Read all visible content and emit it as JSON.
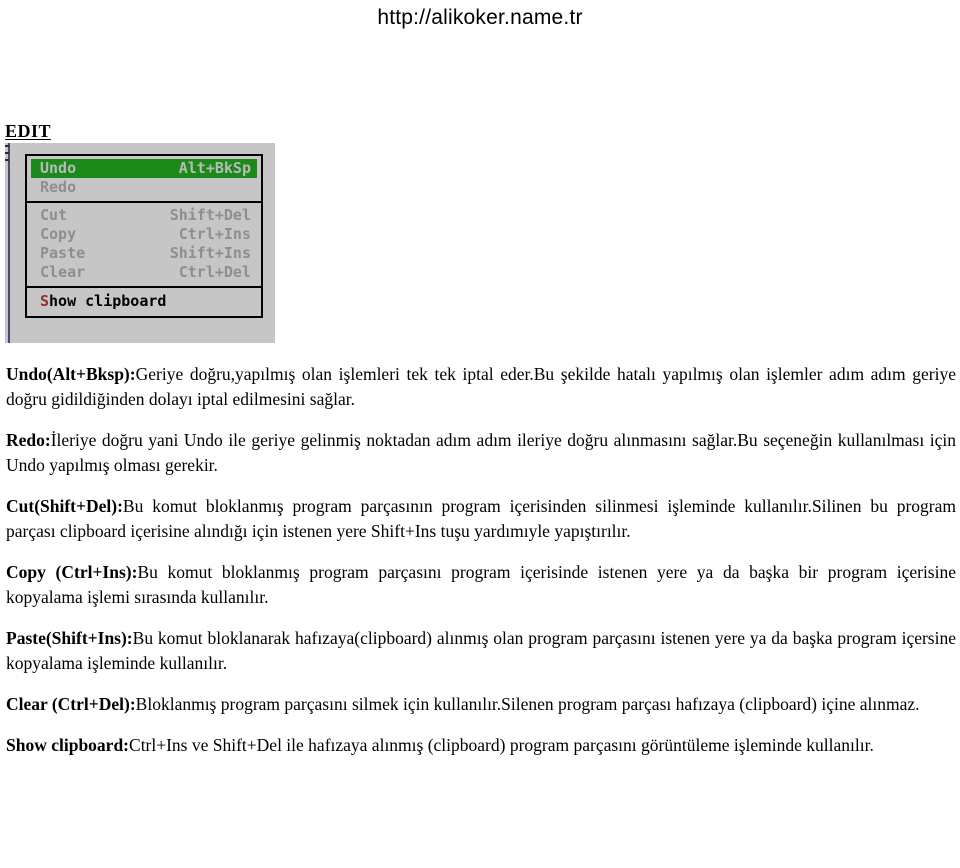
{
  "header": {
    "url": "http://alikoker.name.tr"
  },
  "section": {
    "heading": "EDIT"
  },
  "menu_screenshot": {
    "name": "edit-menu",
    "colors": {
      "panel_background": "#c6c6c6",
      "highlight_background": "#1b8a1b",
      "highlight_text": "#b9b9b9",
      "item_text": "#8e8e8e",
      "accelerator_text": "#9c2b2b",
      "border": "#000000"
    },
    "groups": [
      {
        "items": [
          {
            "label": "Undo",
            "shortcut": "Alt+BkSp",
            "highlighted": true
          },
          {
            "label": "Redo",
            "shortcut": "",
            "highlighted": false
          }
        ]
      },
      {
        "items": [
          {
            "label": "Cut",
            "shortcut": "Shift+Del",
            "highlighted": false
          },
          {
            "label": "Copy",
            "shortcut": "Ctrl+Ins",
            "highlighted": false
          },
          {
            "label": "Paste",
            "shortcut": "Shift+Ins",
            "highlighted": false
          },
          {
            "label": "Clear",
            "shortcut": "Ctrl+Del",
            "highlighted": false
          }
        ]
      },
      {
        "items": [
          {
            "label": "Show clipboard",
            "accelerator": "S",
            "rest": "how clipboard",
            "shortcut": "",
            "highlighted": false
          }
        ]
      }
    ]
  },
  "paragraphs": [
    {
      "id": "undo",
      "lead": "Undo(Alt+Bksp):",
      "text": "Geriye doğru,yapılmış olan işlemleri tek tek iptal eder.Bu şekilde hatalı yapılmış olan işlemler adım adım geriye doğru gidildiğinden dolayı iptal edilmesini sağlar."
    },
    {
      "id": "redo",
      "lead": "Redo:",
      "text": "İleriye doğru yani Undo ile geriye gelinmiş noktadan adım adım ileriye doğru alınmasını sağlar.Bu seçeneğin kullanılması için Undo yapılmış olması gerekir."
    },
    {
      "id": "cut",
      "lead": "Cut(Shift+Del):",
      "text": "Bu komut bloklanmış program parçasının program içerisinden silinmesi işleminde kullanılır.Silinen bu program parçası clipboard içerisine alındığı için istenen yere Shift+Ins tuşu yardımıyle yapıştırılır."
    },
    {
      "id": "copy",
      "lead": "Copy  (Ctrl+Ins):",
      "text": "Bu komut bloklanmış program parçasını program içerisinde istenen yere ya da başka bir program içerisine kopyalama işlemi sırasında kullanılır."
    },
    {
      "id": "paste",
      "lead": "Paste(Shift+Ins):",
      "text": "Bu komut bloklanarak hafızaya(clipboard) alınmış olan program parçasını istenen yere ya da başka program içersine kopyalama işleminde kullanılır."
    },
    {
      "id": "clear",
      "lead": "Clear (Ctrl+Del):",
      "text": "Bloklanmış program parçasını silmek için kullanılır.Silenen program parçası hafızaya (clipboard) içine alınmaz."
    },
    {
      "id": "show-clipboard",
      "lead": "Show clipboard:",
      "text": "Ctrl+Ins ve Shift+Del ile hafızaya alınmış (clipboard) program parçasını görüntüleme işleminde kullanılır."
    }
  ]
}
